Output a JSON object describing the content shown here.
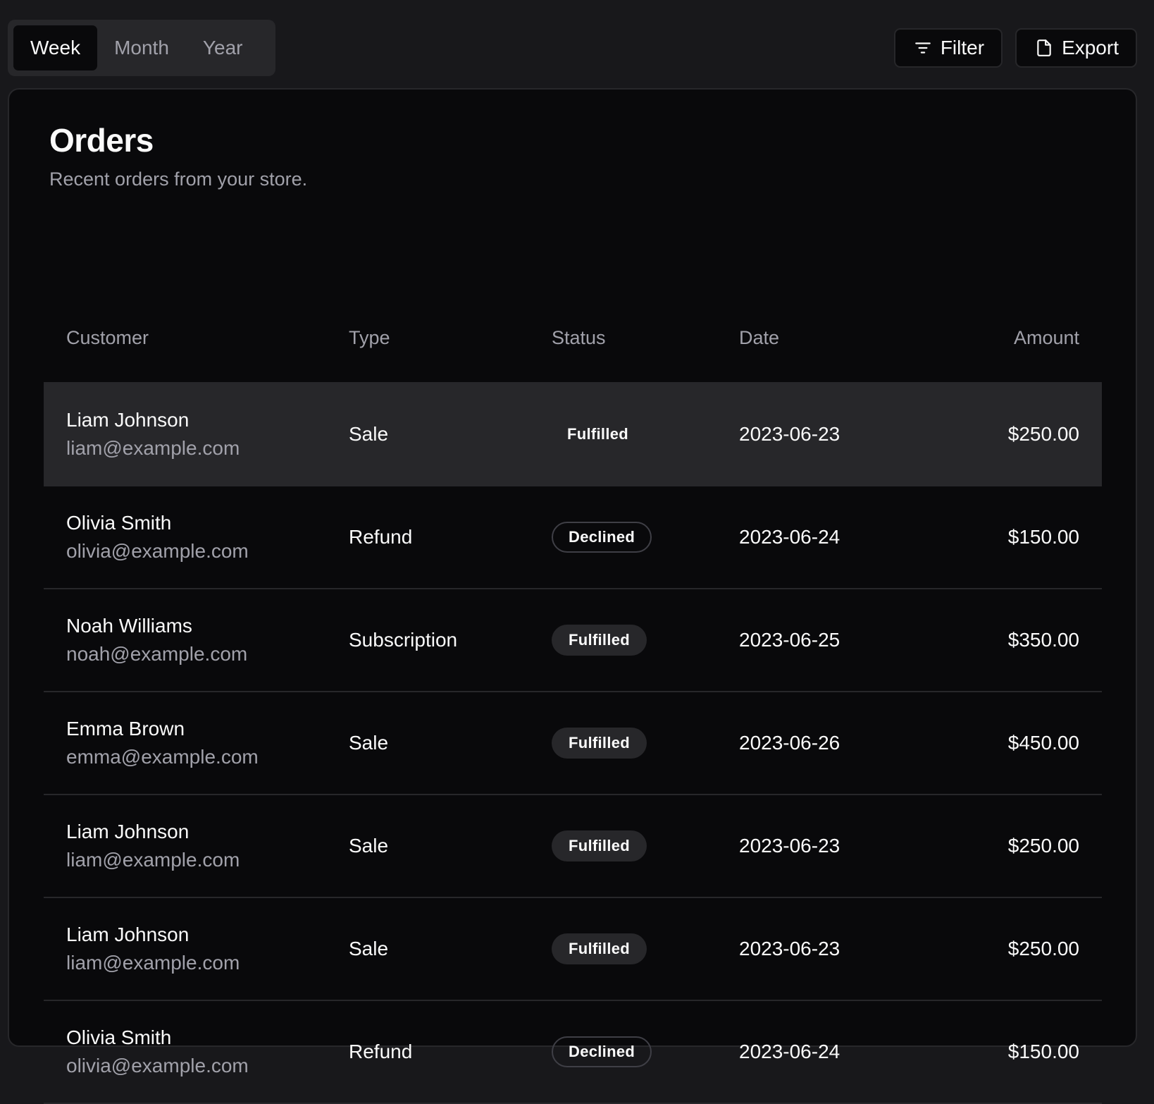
{
  "tabs": [
    {
      "label": "Week",
      "active": true
    },
    {
      "label": "Month",
      "active": false
    },
    {
      "label": "Year",
      "active": false
    }
  ],
  "actions": {
    "filter_label": "Filter",
    "filter_icon": "filter-lines-icon",
    "export_label": "Export",
    "export_icon": "file-icon"
  },
  "card": {
    "title": "Orders",
    "description": "Recent orders from your store."
  },
  "table": {
    "headers": {
      "customer": "Customer",
      "type": "Type",
      "status": "Status",
      "date": "Date",
      "amount": "Amount"
    },
    "rows": [
      {
        "name": "Liam Johnson",
        "email": "liam@example.com",
        "type": "Sale",
        "status": "Fulfilled",
        "date": "2023-06-23",
        "amount": "$250.00"
      },
      {
        "name": "Olivia Smith",
        "email": "olivia@example.com",
        "type": "Refund",
        "status": "Declined",
        "date": "2023-06-24",
        "amount": "$150.00"
      },
      {
        "name": "Noah Williams",
        "email": "noah@example.com",
        "type": "Subscription",
        "status": "Fulfilled",
        "date": "2023-06-25",
        "amount": "$350.00"
      },
      {
        "name": "Emma Brown",
        "email": "emma@example.com",
        "type": "Sale",
        "status": "Fulfilled",
        "date": "2023-06-26",
        "amount": "$450.00"
      },
      {
        "name": "Liam Johnson",
        "email": "liam@example.com",
        "type": "Sale",
        "status": "Fulfilled",
        "date": "2023-06-23",
        "amount": "$250.00"
      },
      {
        "name": "Liam Johnson",
        "email": "liam@example.com",
        "type": "Sale",
        "status": "Fulfilled",
        "date": "2023-06-23",
        "amount": "$250.00"
      },
      {
        "name": "Olivia Smith",
        "email": "olivia@example.com",
        "type": "Refund",
        "status": "Declined",
        "date": "2023-06-24",
        "amount": "$150.00"
      }
    ]
  },
  "colors": {
    "background": "#18181b",
    "card": "#09090b",
    "border": "#27272a",
    "muted_text": "#a1a1aa",
    "text": "#fafafa"
  }
}
